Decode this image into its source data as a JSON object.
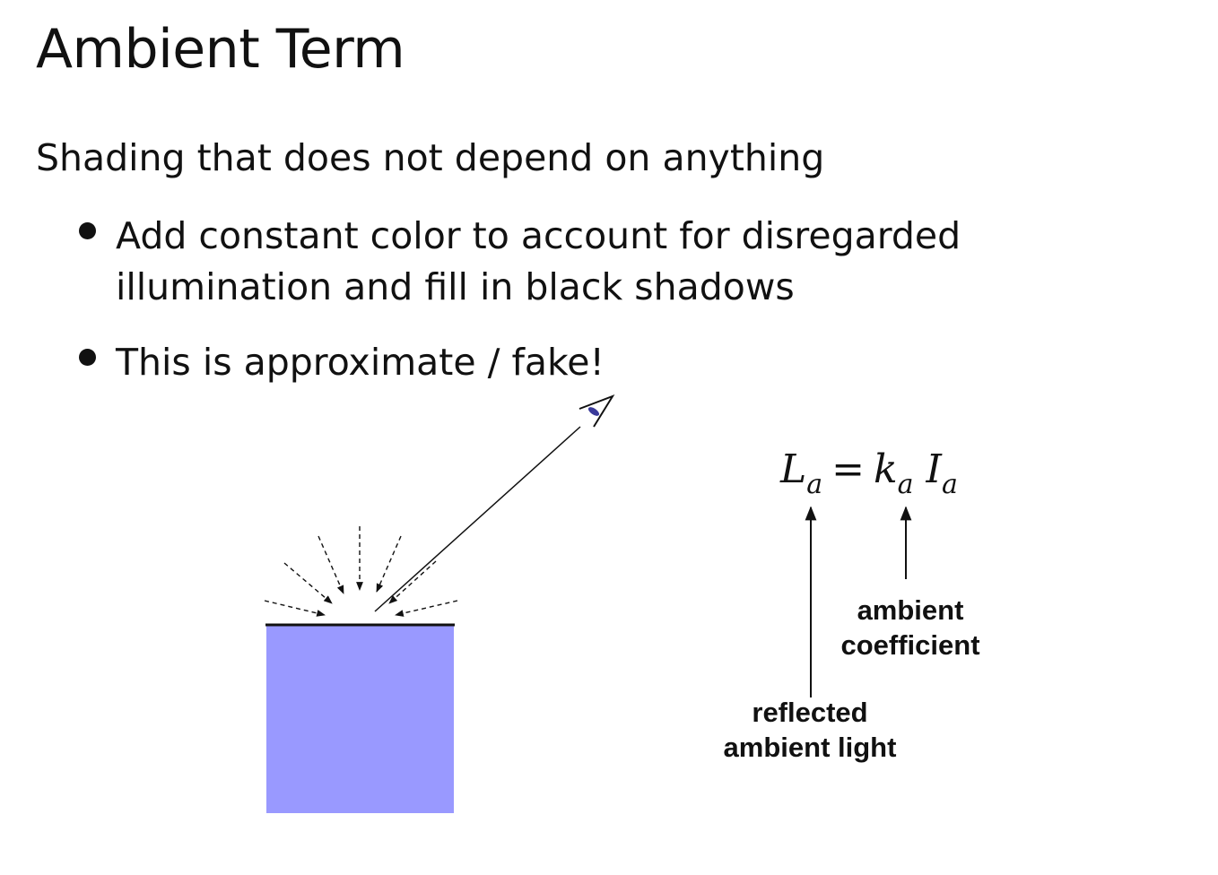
{
  "slide": {
    "title": "Ambient Term",
    "subtitle": "Shading that does not depend on anything",
    "bullets": [
      {
        "line1": "Add constant color to account for disregarded",
        "line2": "illumination and fill in black shadows"
      },
      {
        "line1": "This is approximate / fake!"
      }
    ]
  },
  "formula": {
    "L": "L",
    "L_sub": "a",
    "equals": "=",
    "k": "k",
    "k_sub": "a",
    "I": "I",
    "I_sub": "a"
  },
  "labels": {
    "coefficient_line1": "ambient",
    "coefficient_line2": "coefficient",
    "reflected_line1": "reflected",
    "reflected_line2": "ambient light"
  },
  "colors": {
    "surface_fill": "#9999ff",
    "eye_pupil": "#3a3a9a"
  },
  "icons": {
    "eye": "eye-icon"
  }
}
